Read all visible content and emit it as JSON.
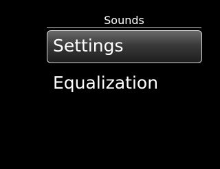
{
  "header": {
    "title": "Sounds"
  },
  "menu": {
    "items": [
      {
        "label": "Settings",
        "selected": true
      },
      {
        "label": "Equalization",
        "selected": false
      }
    ]
  },
  "colors": {
    "background": "#000000",
    "text": "#ffffff",
    "selection_border": "#d9d9d9",
    "selection_fill_top": "#6a6a6a",
    "selection_fill_bottom": "#1e1e1e"
  }
}
